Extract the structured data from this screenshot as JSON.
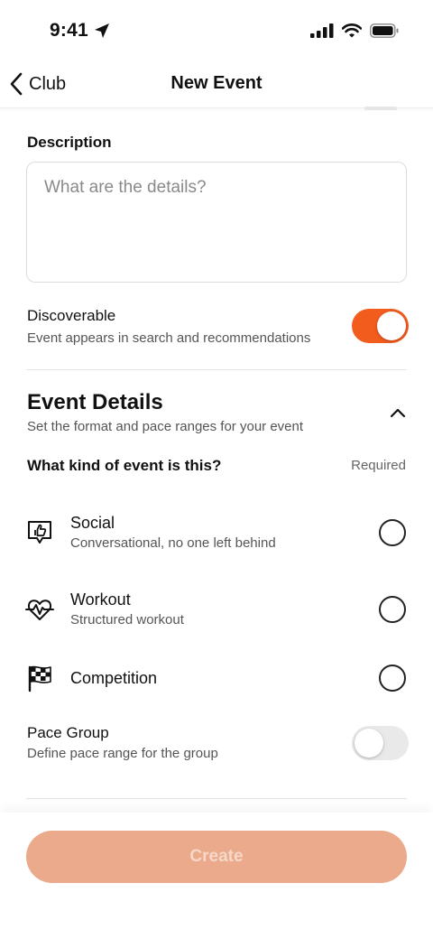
{
  "status_bar": {
    "time": "9:41"
  },
  "nav": {
    "back_label": "Club",
    "title": "New Event"
  },
  "description": {
    "label": "Description",
    "value": "",
    "placeholder": "What are the details?"
  },
  "discoverable": {
    "title": "Discoverable",
    "subtitle": "Event appears in search and recommendations",
    "enabled": true
  },
  "event_details": {
    "title": "Event Details",
    "subtitle": "Set the format and pace ranges for your event",
    "question": "What kind of event is this?",
    "required_label": "Required",
    "options": [
      {
        "title": "Social",
        "subtitle": "Conversational, no one left behind",
        "icon": "speech-bubble-thumbs-up-icon",
        "selected": false
      },
      {
        "title": "Workout",
        "subtitle": "Structured workout",
        "icon": "heart-pulse-icon",
        "selected": false
      },
      {
        "title": "Competition",
        "subtitle": "",
        "icon": "checkered-flag-icon",
        "selected": false
      }
    ]
  },
  "pace_group": {
    "title": "Pace Group",
    "subtitle": "Define pace range for the group",
    "enabled": false
  },
  "footer": {
    "create_label": "Create"
  },
  "colors": {
    "accent": "#f25c1d",
    "create_disabled_bg": "#eaaa8b",
    "create_disabled_text": "#f7d8c8"
  }
}
